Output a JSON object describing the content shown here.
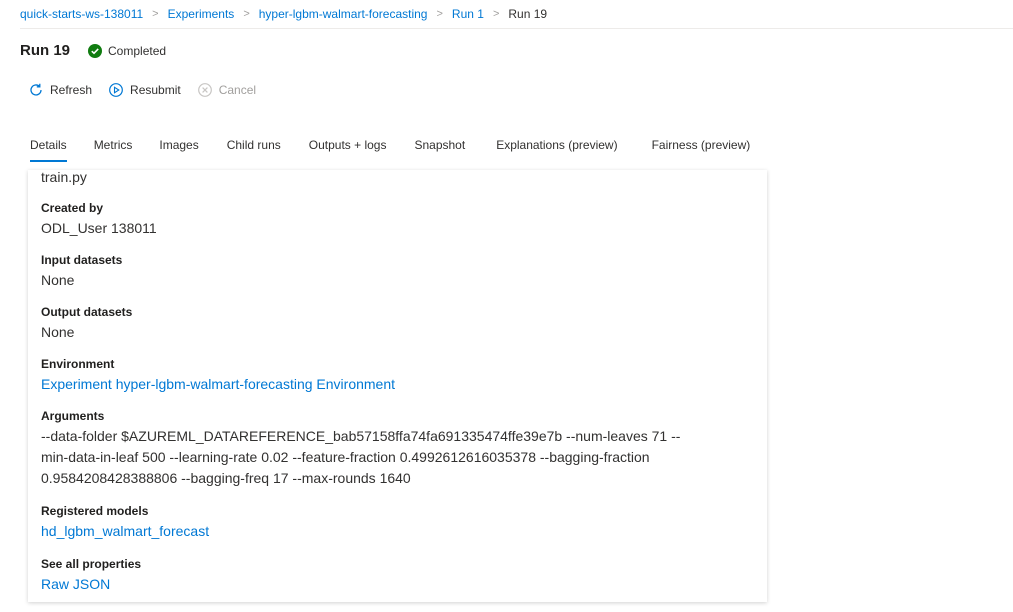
{
  "breadcrumb": {
    "items": [
      "quick-starts-ws-138011",
      "Experiments",
      "hyper-lgbm-walmart-forecasting",
      "Run 1",
      "Run 19"
    ],
    "separator": ">"
  },
  "run": {
    "title": "Run 19",
    "status": "Completed",
    "status_color": "#107c10"
  },
  "toolbar": {
    "refresh": "Refresh",
    "resubmit": "Resubmit",
    "cancel": "Cancel"
  },
  "tabs": [
    "Details",
    "Metrics",
    "Images",
    "Child runs",
    "Outputs + logs",
    "Snapshot",
    "Explanations (preview)",
    "Fairness (preview)"
  ],
  "details": {
    "script": "train.py",
    "created_by_label": "Created by",
    "created_by": "ODL_User 138011",
    "input_datasets_label": "Input datasets",
    "input_datasets": "None",
    "output_datasets_label": "Output datasets",
    "output_datasets": "None",
    "environment_label": "Environment",
    "environment": "Experiment hyper-lgbm-walmart-forecasting Environment",
    "arguments_label": "Arguments",
    "arguments_line1": "--data-folder $AZUREML_DATAREFERENCE_bab57158ffa74fa691335474ffe39e7b --num-leaves 71 --",
    "arguments_line2": "min-data-in-leaf 500 --learning-rate 0.02 --feature-fraction 0.4992612616035378 --bagging-fraction",
    "arguments_line3": "0.9584208428388806 --bagging-freq 17 --max-rounds 1640",
    "registered_models_label": "Registered models",
    "registered_models": "hd_lgbm_walmart_forecast",
    "see_all_label": "See all properties",
    "raw_json": "Raw JSON"
  },
  "colors": {
    "accent": "#0078d4",
    "text": "#323130",
    "muted": "#a19f9d"
  }
}
